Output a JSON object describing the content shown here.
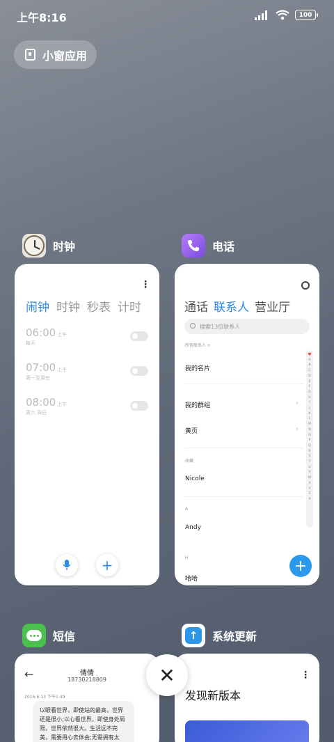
{
  "status_bar": {
    "time": "上午8:16",
    "battery": "100"
  },
  "small_window": {
    "label": "小窗应用"
  },
  "clock_app": {
    "name": "时钟",
    "tabs": [
      "闹钟",
      "时钟",
      "秒表",
      "计时"
    ],
    "alarms": [
      {
        "time": "06:00",
        "ampm": "上午",
        "days": "每天"
      },
      {
        "time": "07:00",
        "ampm": "上午",
        "days": "周一至周五"
      },
      {
        "time": "08:00",
        "ampm": "上午",
        "days": "周六 周日"
      }
    ]
  },
  "phone_app": {
    "name": "电话",
    "tabs": [
      "通话",
      "联系人",
      "营业厅"
    ],
    "search_placeholder": "搜索13位联系人",
    "all_contacts": "所有联系人 ≎",
    "my_card": "我的名片",
    "my_groups": "我的群组",
    "yellow_pages": "黄页",
    "favorites_header": "收藏",
    "favorite_contact": "Nicole",
    "section_a": "A",
    "contact_a": "Andy",
    "section_h": "H",
    "contact_h": "哈哈",
    "alphabet": [
      "A",
      "B",
      "C",
      "D",
      "E",
      "F",
      "G",
      "H",
      "I",
      "J",
      "K",
      "L",
      "M",
      "N",
      "O",
      "P",
      "Q",
      "R",
      "S",
      "T",
      "U",
      "V",
      "W",
      "X",
      "Y",
      "Z",
      "#"
    ]
  },
  "sms_app": {
    "name": "短信",
    "contact_name": "倩倩",
    "contact_number": "18730218809",
    "timestamp": "2016-6-13 下午1:49",
    "message": "以眼看世界，即使站的最高，世界还是很小;以心看世界，即使身处局限，世界依然很大。生活远不完美，需要用心去体会;无需拥有太"
  },
  "update_app": {
    "name": "系统更新",
    "headline": "发现新版本"
  },
  "colors": {
    "accent": "#2c8ae6",
    "fab": "#2c9aec"
  }
}
